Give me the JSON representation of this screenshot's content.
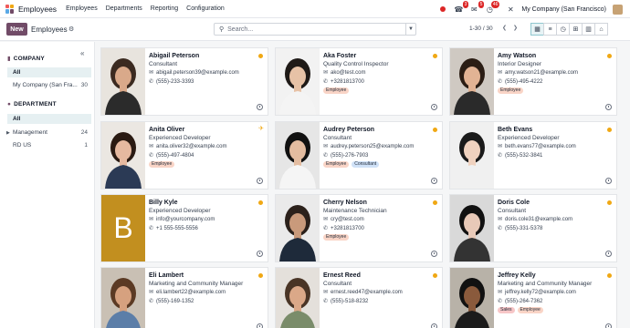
{
  "navbar": {
    "app_name": "Employees",
    "menu": [
      "Employees",
      "Departments",
      "Reporting",
      "Configuration"
    ],
    "chat_badge": "5",
    "activity_badge": "46",
    "phone_badge": "3",
    "company": "My Company (San Francisco)"
  },
  "control": {
    "new_label": "New",
    "title": "Employees",
    "search_placeholder": "Search...",
    "pager": "1-30 / 30"
  },
  "sidebar": {
    "company_header": "COMPANY",
    "company_items": [
      {
        "label": "All",
        "count": ""
      },
      {
        "label": "My Company (San Fra...",
        "count": "30"
      }
    ],
    "department_header": "DEPARTMENT",
    "department_items": [
      {
        "label": "All",
        "count": ""
      },
      {
        "label": "Management",
        "count": "24"
      },
      {
        "label": "RD US",
        "count": "1"
      }
    ]
  },
  "employees": [
    {
      "name": "Abigail Peterson",
      "job": "Consultant",
      "email": "abigail.peterson39@example.com",
      "phone": "(555)-233-3393",
      "tags": [],
      "status": "dot"
    },
    {
      "name": "Aka Foster",
      "job": "Quality Control Inspector",
      "email": "ako@test.com",
      "phone": "+3281813700",
      "tags": [
        "Employee"
      ],
      "status": "dot"
    },
    {
      "name": "Amy Watson",
      "job": "Interior Designer",
      "email": "amy.watson21@example.com",
      "phone": "(555)-495-4222",
      "tags": [
        "Employee"
      ],
      "status": "dot"
    },
    {
      "name": "Anita Oliver",
      "job": "Experienced Developer",
      "email": "anita.oliver32@example.com",
      "phone": "(555)-497-4804",
      "tags": [
        "Employee"
      ],
      "status": "plane"
    },
    {
      "name": "Audrey Peterson",
      "job": "Consultant",
      "email": "audrey.peterson25@example.com",
      "phone": "(555)-276-7903",
      "tags": [
        "Employee",
        "Consultant"
      ],
      "status": "dot"
    },
    {
      "name": "Beth Evans",
      "job": "Experienced Developer",
      "email": "beth.evans77@example.com",
      "phone": "(555)-532-3841",
      "tags": [],
      "status": "dot"
    },
    {
      "name": "Billy Kyle",
      "job": "Experienced Developer",
      "email": "info@yourcompany.com",
      "phone": "+1 555-555-5556",
      "tags": [],
      "status": "dot",
      "letter": "B"
    },
    {
      "name": "Cherry Nelson",
      "job": "Maintenance Technician",
      "email": "cry@test.com",
      "phone": "+3281813700",
      "tags": [
        "Employee"
      ],
      "status": "dot"
    },
    {
      "name": "Doris Cole",
      "job": "Consultant",
      "email": "doris.cole31@example.com",
      "phone": "(555)-331-5378",
      "tags": [],
      "status": "dot"
    },
    {
      "name": "Eli Lambert",
      "job": "Marketing and Community Manager",
      "email": "eli.lambert22@example.com",
      "phone": "(555)-169-1352",
      "tags": [],
      "status": "dot"
    },
    {
      "name": "Ernest Reed",
      "job": "Consultant",
      "email": "ernest.reed47@example.com",
      "phone": "(555)-518-8232",
      "tags": [],
      "status": "dot"
    },
    {
      "name": "Jeffrey Kelly",
      "job": "Marketing and Community Manager",
      "email": "jeffrey.kelly72@example.com",
      "phone": "(555)-264-7362",
      "tags": [
        "Sales",
        "Employee"
      ],
      "status": "dot"
    }
  ],
  "colors": {
    "brand": "#714b67",
    "status_dot": "#f0a814",
    "tag_employee": "#f9d4c6",
    "tag_consultant": "#cfe1f7",
    "tag_sales": "#f7c6c7",
    "letter_avatar": "#c28f1f"
  }
}
